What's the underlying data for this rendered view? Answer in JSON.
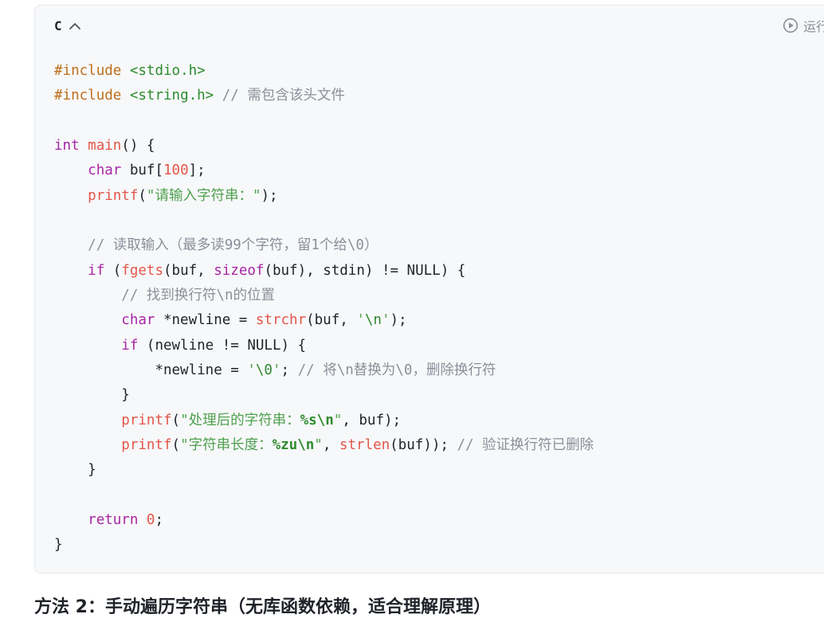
{
  "code_block": {
    "language": "C",
    "run_label": "运行",
    "lines": {
      "l1": {
        "p": "#",
        "kw": "include",
        "sp": " ",
        "hdr": "<stdio.h>"
      },
      "l2": {
        "p": "#",
        "kw": "include",
        "sp": " ",
        "hdr": "<string.h>",
        "cmt": " // 需包含该头文件"
      },
      "l4": {
        "t": "int",
        "sp": " ",
        "fn": "main",
        "rest": "() {"
      },
      "l5": {
        "indent": "    ",
        "t": "char",
        "rest1": " buf[",
        "num": "100",
        "rest2": "];"
      },
      "l6": {
        "indent": "    ",
        "fn": "printf",
        "o": "(",
        "str": "\"请输入字符串：\"",
        "c": ");"
      },
      "l8": {
        "indent": "    ",
        "cmt": "// 读取输入（最多读99个字符，留1个给\\0）"
      },
      "l9": {
        "indent": "    ",
        "kw": "if",
        "a": " (",
        "fn1": "fgets",
        "b": "(buf, ",
        "fn2": "sizeof",
        "c": "(buf), stdin) != NULL) {"
      },
      "l10": {
        "indent": "        ",
        "cmt": "// 找到换行符\\n的位置"
      },
      "l11": {
        "indent": "        ",
        "t": "char",
        "a": " *newline = ",
        "fn": "strchr",
        "b": "(buf, ",
        "s1": "'",
        "esc": "\\n",
        "s2": "'",
        "c": ");"
      },
      "l12": {
        "indent": "        ",
        "kw": "if",
        "rest": " (newline != NULL) {"
      },
      "l13": {
        "indent": "            ",
        "a": "*newline = ",
        "s1": "'",
        "esc": "\\0",
        "s2": "'",
        "b": ";",
        "cmt": " // 将\\n替换为\\0，删除换行符"
      },
      "l14": {
        "indent": "        ",
        "rest": "}"
      },
      "l15": {
        "indent": "        ",
        "fn": "printf",
        "o": "(",
        "s1": "\"处理后的字符串：",
        "fmt": "%s\\n",
        "s2": "\"",
        "c": ", buf);"
      },
      "l16": {
        "indent": "        ",
        "fn": "printf",
        "o": "(",
        "s1": "\"字符串长度：",
        "fmt": "%zu\\n",
        "s2": "\"",
        "a": ", ",
        "fn2": "strlen",
        "c": "(buf));",
        "cmt": " // 验证换行符已删除"
      },
      "l17": {
        "indent": "    ",
        "rest": "}"
      },
      "l19": {
        "indent": "    ",
        "kw": "return",
        "sp": " ",
        "num": "0",
        "rest": ";"
      },
      "l20": {
        "rest": "}"
      }
    }
  },
  "next_section": {
    "heading": "方法 2：手动遍历字符串（无库函数依赖，适合理解原理）"
  },
  "colors": {
    "card_bg": "#f7f8fa",
    "keyword": "#a626a4",
    "function": "#e45649",
    "string": "#50a14f",
    "comment": "#8a9099"
  },
  "icons": {
    "collapse": "chevron-up-icon",
    "run": "play-circle-icon"
  }
}
